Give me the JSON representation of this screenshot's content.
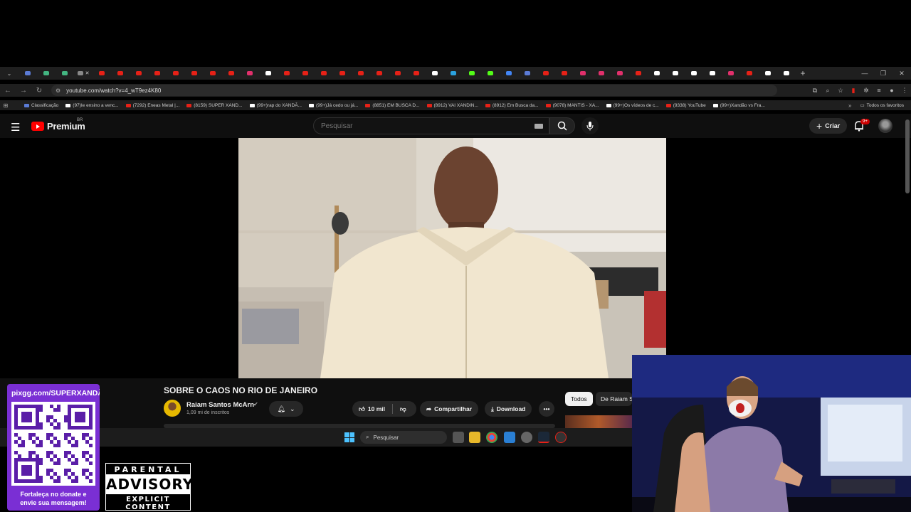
{
  "browser": {
    "url": "youtube.com/watch?v=4_wT9ez4K80",
    "tab_favicon_colors": [
      "#5b7bd5",
      "#43b581",
      "#43b581",
      "#888888",
      "#e62117",
      "#e62117",
      "#e62117",
      "#e62117",
      "#e62117",
      "#e62117",
      "#e62117",
      "#e62117",
      "#e1306c",
      "#ffffff",
      "#e62117",
      "#e62117",
      "#e62117",
      "#e62117",
      "#e62117",
      "#e62117",
      "#e62117",
      "#e62117",
      "#ffffff",
      "#2aa1de",
      "#53fc18",
      "#53fc18",
      "#4285f4",
      "#5b7bd5",
      "#e62117",
      "#e62117",
      "#e1306c",
      "#e1306c",
      "#e1306c",
      "#e62117",
      "#ffffff",
      "#ffffff",
      "#ffffff",
      "#ffffff",
      "#e1306c",
      "#e62117",
      "#ffffff",
      "#ffffff"
    ],
    "bookmarks": [
      {
        "label": "Classificação",
        "color": "#5b7bd5"
      },
      {
        "label": "(97)Ie ensino a venc...",
        "color": "#ffffff"
      },
      {
        "label": "(7292) Eneas Metal |...",
        "color": "#e62117"
      },
      {
        "label": "(8159) SUPER XAND...",
        "color": "#e62117"
      },
      {
        "label": "(99+)rap do XANDÃ...",
        "color": "#ffffff"
      },
      {
        "label": "(99+)Já cedo ou já...",
        "color": "#ffffff"
      },
      {
        "label": "(8851) EM BUSCA D...",
        "color": "#e62117"
      },
      {
        "label": "(8912) VAI XANDIN...",
        "color": "#e62117"
      },
      {
        "label": "(8912) Em Busca da...",
        "color": "#e62117"
      },
      {
        "label": "(9078) MANTIS - XA...",
        "color": "#e62117"
      },
      {
        "label": "(99+)Os vídeos de c...",
        "color": "#ffffff"
      },
      {
        "label": "(9338) YouTube",
        "color": "#e62117"
      },
      {
        "label": "(99+)Xandão vs Fra...",
        "color": "#ffffff"
      }
    ],
    "all_bookmarks_label": "Todos os favoritos"
  },
  "youtube": {
    "logo_text": "Premium",
    "country_code": "BR",
    "search_placeholder": "Pesquisar",
    "create_label": "Criar",
    "notification_badge": "9+",
    "video_title": "SOBRE O CAOS NO RIO DE JANEIRO",
    "channel_name": "Raiam Santos McArn",
    "subscribers": "1,09 mi de inscritos",
    "likes": "10 mil",
    "share_label": "Compartilhar",
    "download_label": "Download",
    "chip_all": "Todos",
    "chip_from": "De Raiam Santos"
  },
  "taskbar": {
    "search_placeholder": "Pesquisar"
  },
  "overlay": {
    "donate_url": "pixgg.com/SUPERXANDÃO",
    "donate_message_line1": "Fortaleça no donate e",
    "donate_message_line2": "envie sua mensagem!",
    "advisory_top": "PARENTAL",
    "advisory_mid": "ADVISORY",
    "advisory_bottom": "EXPLICIT CONTENT"
  },
  "colors": {
    "youtube_red": "#ff0000",
    "donate_purple": "#7a2fd4",
    "background": "#0f0f0f"
  }
}
